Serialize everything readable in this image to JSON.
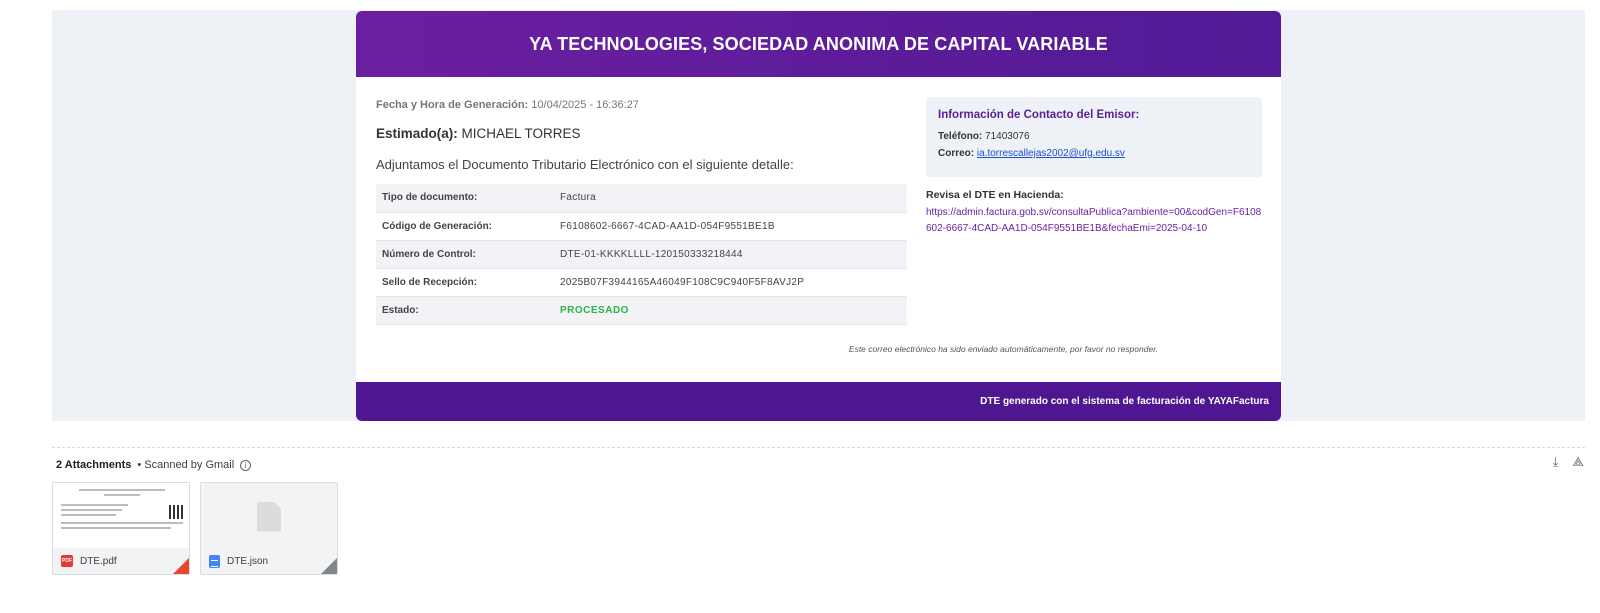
{
  "email": {
    "header_title": "YA TECHNOLOGIES, SOCIEDAD ANONIMA DE CAPITAL VARIABLE",
    "generation_label": "Fecha y Hora de Generación:",
    "generation_value": "10/04/2025 - 16:36:27",
    "greeting_label": "Estimado(a):",
    "greeting_name": "MICHAEL TORRES",
    "intro_text": "Adjuntamos el Documento Tributario Electrónico con el siguiente detalle:",
    "details": [
      {
        "key": "Tipo de documento:",
        "value": "Factura"
      },
      {
        "key": "Código de Generación:",
        "value": "F6108602-6667-4CAD-AA1D-054F9551BE1B"
      },
      {
        "key": "Número de Control:",
        "value": "DTE-01-KKKKLLLL-120150333218444"
      },
      {
        "key": "Sello de Recepción:",
        "value": "2025B07F3944165A46049F108C9C940F5F8AVJ2P"
      },
      {
        "key": "Estado:",
        "value": "PROCESADO"
      }
    ],
    "contact": {
      "title": "Información de Contacto del Emisor:",
      "phone_label": "Teléfono:",
      "phone_value": "71403076",
      "email_label": "Correo:",
      "email_value": "ia.torrescallejas2002@ufg.edu.sv"
    },
    "verify": {
      "title": "Revisa el DTE en Hacienda:",
      "url": "https://admin.factura.gob.sv/consultaPublica?ambiente=00&codGen=F6108602-6667-4CAD-AA1D-054F9551BE1B&fechaEmi=2025-04-10"
    },
    "auto_note": "Este correo electrónico ha sido enviado automáticamente, por favor no responder.",
    "footer_text": "DTE generado con el sistema de facturación de YAYAFactura",
    "colors": {
      "header": "#6b1fa0",
      "footer": "#4e1690",
      "status_ok": "#2db34a",
      "link": "#1a4fd6"
    }
  },
  "attachments": {
    "count_label": "2 Attachments",
    "scanned_label": "• Scanned by Gmail",
    "info_icon": "ⓘ",
    "download_all_icon": "download-icon",
    "save_drive_icon": "add-to-drive-icon",
    "files": [
      {
        "name": "DTE.pdf",
        "type": "pdf"
      },
      {
        "name": "DTE.json",
        "type": "doc"
      }
    ]
  }
}
